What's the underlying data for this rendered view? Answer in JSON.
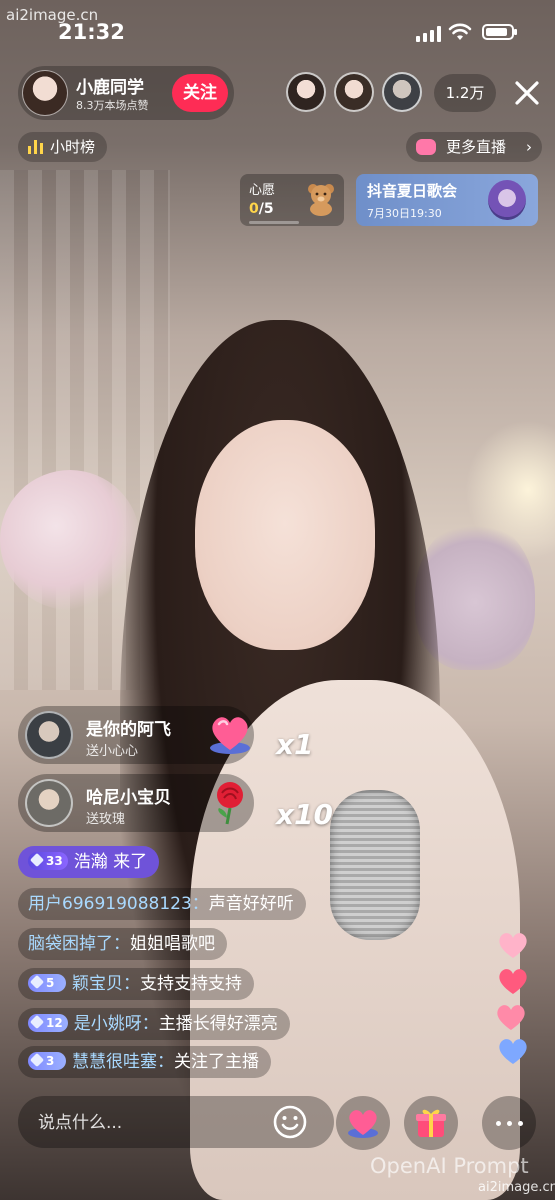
{
  "watermarks": {
    "top": "ai2image.cn",
    "bottom": "OpenAI Prompt",
    "bottom_small": "ai2image.cn"
  },
  "status_bar": {
    "time": "21:32"
  },
  "host": {
    "name": "小鹿同学",
    "likes": "8.3万本场点赞",
    "follow_label": "关注"
  },
  "viewers": {
    "count": "1.2万"
  },
  "hour_rank": {
    "label": "小时榜"
  },
  "more_live": {
    "label": "更多直播",
    "chevron": "›"
  },
  "wish": {
    "title": "心愿",
    "current": "0",
    "total": "/5",
    "icon": "bear-icon"
  },
  "event": {
    "title": "抖音夏日歌会",
    "time": "7月30日19:30"
  },
  "gifts": [
    {
      "sender": "是你的阿飞",
      "desc": "送小心心",
      "count": "x1",
      "icon": "heart-gift-icon"
    },
    {
      "sender": "哈尼小宝贝",
      "desc": "送玫瑰",
      "count": "x10",
      "icon": "rose-gift-icon"
    }
  ],
  "chat": [
    {
      "level": "33",
      "user": "浩瀚",
      "message": "来了",
      "type": "join"
    },
    {
      "level": "",
      "user": "用户696919088123：",
      "message": "声音好好听",
      "type": "msg"
    },
    {
      "level": "",
      "user": "脑袋困掉了：",
      "message": "姐姐唱歌吧",
      "type": "msg"
    },
    {
      "level": "5",
      "user": "颖宝贝：",
      "message": "支持支持支持",
      "type": "msg"
    },
    {
      "level": "12",
      "user": "是小姚呀：",
      "message": "主播长得好漂亮",
      "type": "msg"
    },
    {
      "level": "3",
      "user": "慧慧很哇塞：",
      "message": "关注了主播",
      "type": "msg"
    }
  ],
  "comment": {
    "placeholder": "说点什么..."
  },
  "colors": {
    "follow": "#fe2c55",
    "username": "#a9d9ff",
    "join_bg": "#6f53d9",
    "event_bg": "#7b9bd3"
  }
}
